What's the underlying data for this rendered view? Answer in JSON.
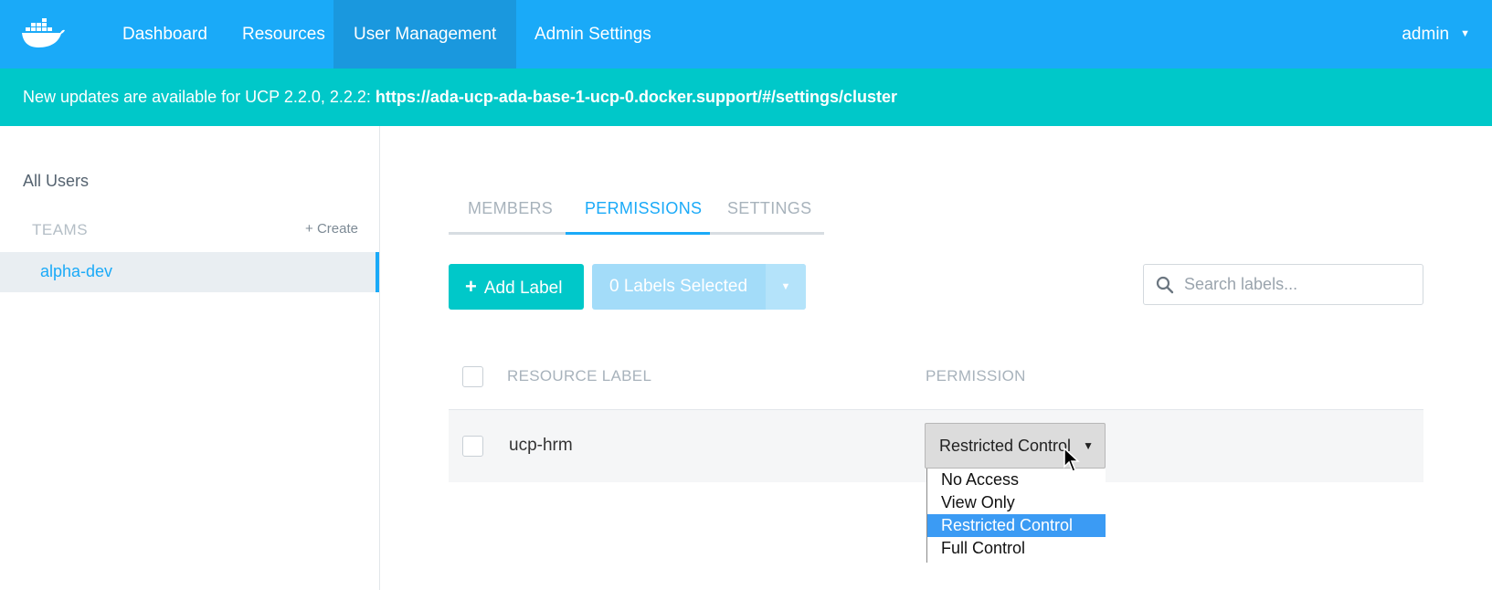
{
  "nav": {
    "items": [
      {
        "label": "Dashboard"
      },
      {
        "label": "Resources"
      },
      {
        "label": "User Management"
      },
      {
        "label": "Admin Settings"
      }
    ],
    "user": "admin"
  },
  "banner": {
    "text": "New updates are available for UCP 2.2.0, 2.2.2: ",
    "link": "https://ada-ucp-ada-base-1-ucp-0.docker.support/#/settings/cluster"
  },
  "sidebar": {
    "all_users": "All Users",
    "teams_heading": "TEAMS",
    "create_label": "+ Create",
    "teams": [
      {
        "label": "alpha-dev"
      }
    ]
  },
  "tabs": [
    {
      "label": "MEMBERS"
    },
    {
      "label": "PERMISSIONS"
    },
    {
      "label": "SETTINGS"
    }
  ],
  "toolbar": {
    "add_label": "Add Label",
    "selected_label": "0 Labels Selected",
    "search_placeholder": "Search labels..."
  },
  "table": {
    "headers": [
      "RESOURCE LABEL",
      "PERMISSION"
    ],
    "rows": [
      {
        "label": "ucp-hrm",
        "permission": "Restricted Control"
      }
    ]
  },
  "permission_options": [
    "No Access",
    "View Only",
    "Restricted Control",
    "Full Control"
  ],
  "colors": {
    "nav": "#1aaaf8",
    "banner": "#00c8c9",
    "accent": "#1aaaf8"
  }
}
